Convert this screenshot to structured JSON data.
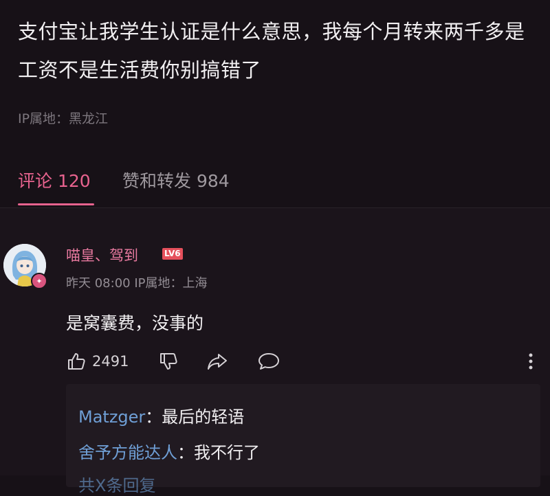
{
  "post": {
    "text": "支付宝让我学生认证是什么意思，我每个月转来两千多是工资不是生活费你别搞错了",
    "ip_location": "IP属地：黑龙江"
  },
  "tabs": [
    {
      "label": "评论 120",
      "active": true
    },
    {
      "label": "赞和转发 984",
      "active": false
    }
  ],
  "comment": {
    "username": "喵皇、驾到",
    "level": "LV6",
    "meta": "昨天 08:00 IP属地：上海",
    "text": "是窝囊费，没事的",
    "like_count": "2491",
    "replies": [
      {
        "name": "Matzger",
        "text": "最后的轻语"
      },
      {
        "name": "舍予方能达人",
        "text": "我不行了"
      },
      {
        "name": "共X条回复",
        "text": ""
      }
    ]
  },
  "colors": {
    "background": "#171117",
    "accent_pink": "#e8638f",
    "reply_name_blue": "#6f9fd6",
    "level_badge_red": "#e5505c"
  },
  "icons": [
    "thumbs-up-icon",
    "thumbs-down-icon",
    "share-icon",
    "reply-bubble-icon",
    "more-vertical-icon"
  ]
}
